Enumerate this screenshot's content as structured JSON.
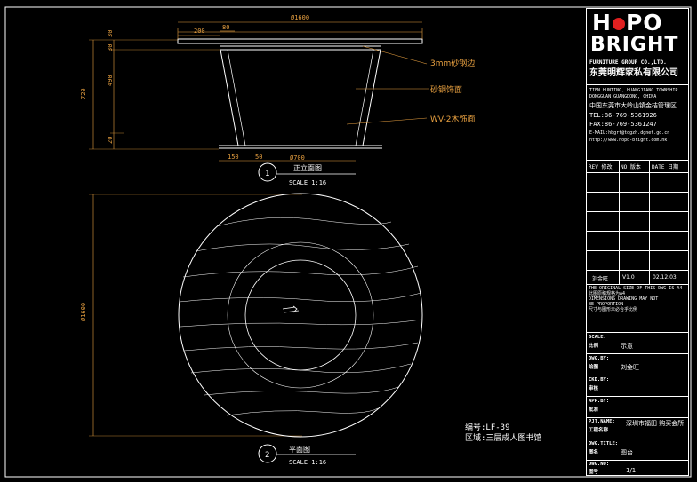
{
  "elevation": {
    "dims": {
      "overall_width": "Ø1600",
      "top_offset": "200",
      "top_step": "80",
      "height_total": "720",
      "height_top": "30",
      "height_top2": "30",
      "height_mid": "490",
      "height_base": "20",
      "base_offset": "150",
      "base_step": "50",
      "base_width": "Ø700"
    },
    "callouts": [
      "3mm砂钢边",
      "砂钢饰面",
      "WV-2木饰面"
    ],
    "view_number": "1",
    "view_title": "正立面图",
    "view_scale": "SCALE 1:16"
  },
  "plan": {
    "diameter": "Ø1600",
    "view_number": "2",
    "view_title": "平面图",
    "view_scale": "SCALE 1:16",
    "code": "编号:LF-39",
    "area": "区域:三层成人图书馆"
  },
  "title_block": {
    "logo_line1_left": "H",
    "logo_line1_right": "PO",
    "logo_line2": "BRIGHT",
    "company_en": "FURNITURE GROUP CO.,LTD.",
    "company_cn": "东莞明辉家私有限公司",
    "address_en_1": "TIEN HUNTING, HUANGJIANG TOWNSHIP",
    "address_en_2": "DONGGUAN GUANGDONG, CHINA",
    "address_cn": "中国东莞市大岭山镇金桔管理区",
    "tel": "TEL:86-769-5361926",
    "fax": "FAX:86-769-5361247",
    "email": "E-MAIL:hbgrt@tdgzh.dgnet.gd.cn",
    "web": "http://www.hopo-bright.com.hk",
    "rev_header": [
      "REV 修改",
      "NO 版本",
      "DATE 日期"
    ],
    "rev_row": [
      "刘金旺",
      "V1.0",
      "02.12.03"
    ],
    "notice_1": "THE ORIGINAL SIZE OF THIS DWG IS A4",
    "notice_2": "此图原稿规格为A4",
    "notice_3": "DIMENSIONS DRAWING MAY NOT",
    "notice_4": "BE PROPORTION",
    "notice_5": "尺寸与图形未必合乎比例",
    "fields": [
      {
        "label_en": "SCALE:",
        "label_cn": "比例",
        "value": "示意"
      },
      {
        "label_en": "DWG.BY:",
        "label_cn": "绘图",
        "value": "刘金旺"
      },
      {
        "label_en": "CKD.BY:",
        "label_cn": "审核",
        "value": ""
      },
      {
        "label_en": "APP.BY:",
        "label_cn": "批准",
        "value": ""
      },
      {
        "label_en": "PJT.NAME:",
        "label_cn": "工程名称",
        "value": "深圳市福田 购买会所"
      },
      {
        "label_en": "DWG.TITLE:",
        "label_cn": "图名",
        "value": "图台"
      },
      {
        "label_en": "DWG.NO:",
        "label_cn": "图号",
        "value": "1/1"
      }
    ]
  }
}
